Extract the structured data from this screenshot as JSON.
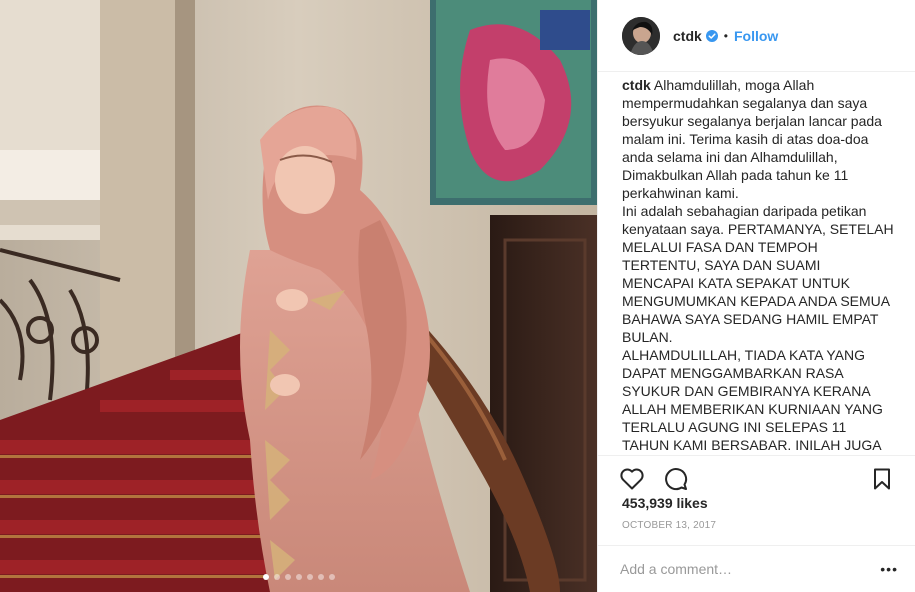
{
  "post": {
    "username": "ctdk",
    "follow_label": "Follow",
    "bullet": "•",
    "caption_author": "ctdk",
    "caption_text": " Alhamdulillah, moga Allah mempermudahkan segalanya dan saya bersyukur segalanya berjalan lancar pada malam ini. Terima kasih di atas doa-doa anda selama ini dan Alhamdulillah, Dimakbulkan Allah pada tahun ke 11 perkahwinan kami.\nIni adalah sebahagian daripada petikan kenyataan saya. PERTAMANYA, SETELAH MELALUI FASA DAN TEMPOH TERTENTU, SAYA DAN SUAMI MENCAPAI KATA SEPAKAT UNTUK MENGUMUMKAN KEPADA ANDA SEMUA BAHAWA SAYA SEDANG HAMIL EMPAT BULAN.\nALHAMDULILLAH, TIADA KATA YANG DAPAT MENGGAMBARKAN RASA SYUKUR DAN GEMBIRANYA KERANA ALLAH MEMBERIKAN KURNIAAN YANG TERLALU AGUNG INI SELEPAS 11 TAHUN KAMI BERSABAR. INILAH JUGA",
    "likes": "453,939 likes",
    "date": "OCTOBER 13, 2017",
    "comment_placeholder": "Add a comment…",
    "more_label": "•••",
    "carousel": {
      "count": 7,
      "active_index": 0
    }
  },
  "icons": {
    "verified": "verified-badge-icon",
    "like": "heart-icon",
    "comment": "comment-bubble-icon",
    "save": "bookmark-icon",
    "more": "more-options-icon"
  },
  "colors": {
    "link": "#3897f0",
    "verified": "#3897f0",
    "muted": "#999999",
    "border": "#efefef",
    "dress": "#d99a8e"
  }
}
